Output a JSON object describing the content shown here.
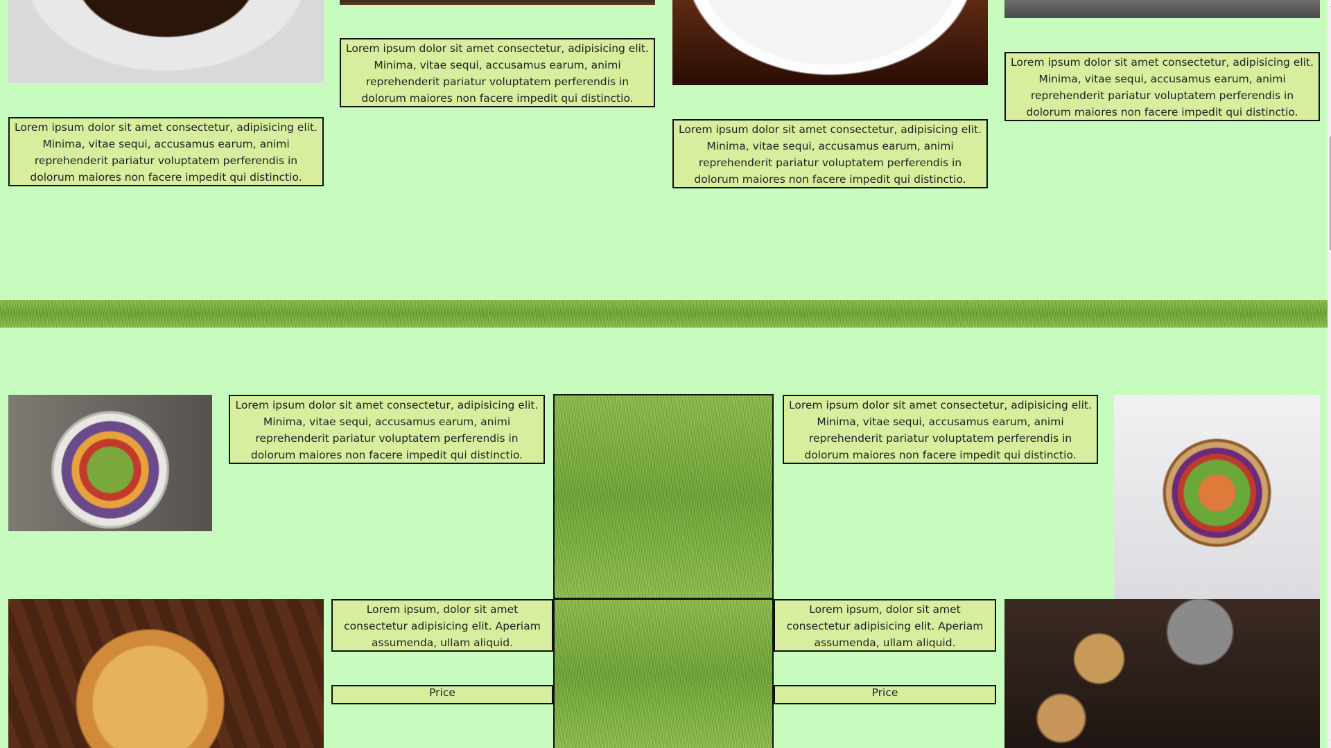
{
  "cards": {
    "long_text": "Lorem ipsum dolor sit amet consectetur, adipisicing elit. Minima, vitae sequi, accusamus earum, animi reprehenderit pariatur voluptatem perferendis in dolorum maiores non facere impedit qui distinctio. Assumenda velit modi commodi.",
    "short_text": "Lorem ipsum, dolor sit amet consectetur adipisicing elit. Aperiam assumenda, ullam aliquid.",
    "price_label": "Price"
  },
  "colors": {
    "page_background": "#c8fcbf",
    "text_box_background": "#d6ee9e",
    "border": "#111111"
  },
  "icons": {
    "scroll_up": "▲",
    "scroll_down": "▼"
  }
}
